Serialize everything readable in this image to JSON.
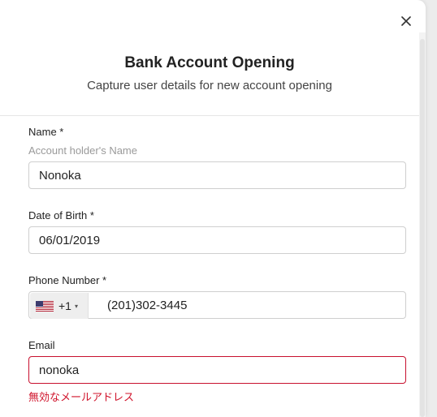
{
  "modal": {
    "title": "Bank Account Opening",
    "subtitle": "Capture user details for new account opening",
    "close_icon": "close-icon"
  },
  "form": {
    "name": {
      "label": "Name *",
      "hint": "Account holder's Name",
      "value": "Nonoka"
    },
    "dob": {
      "label": "Date of Birth *",
      "value": "06/01/2019"
    },
    "phone": {
      "label": "Phone Number *",
      "flag_icon": "us-flag-icon",
      "dial_code": "+1",
      "caret": "▾",
      "value": "(201)302-3445"
    },
    "email": {
      "label": "Email",
      "value": "nonoka",
      "error": "無効なメールアドレス"
    }
  },
  "colors": {
    "error": "#c8102e",
    "border": "#cfcfcf",
    "prefix_bg": "#eeeeee"
  }
}
